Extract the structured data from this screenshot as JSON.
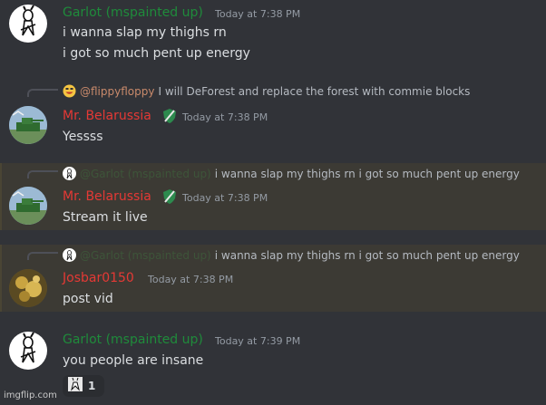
{
  "messages": [
    {
      "username": "Garlot (mspainted up)",
      "timestamp": "Today at 7:38 PM",
      "lines": [
        "i wanna slap my thighs rn",
        "i got so much pent up energy"
      ]
    },
    {
      "reply": {
        "name": "@flippyfloppy",
        "text": "I will DeForest and replace the forest with commie blocks",
        "icon": "grinning-face-emoji-icon"
      },
      "username": "Mr. Belarussia",
      "timestamp": "Today at 7:38 PM",
      "lines": [
        "Yessss"
      ],
      "badge": "sword-shield-icon"
    },
    {
      "reply": {
        "name": "@Garlot (mspainted up)",
        "text": "i wanna slap my thighs rn i got so much pent up energy"
      },
      "username": "Mr. Belarussia",
      "timestamp": "Today at 7:38 PM",
      "lines": [
        "Stream it live"
      ],
      "badge": "sword-shield-icon",
      "highlighted": true
    },
    {
      "reply": {
        "name": "@Garlot (mspainted up)",
        "text": "i wanna slap my thighs rn i got so much pent up energy"
      },
      "username": "Josbar0150",
      "timestamp": "Today at 7:38 PM",
      "lines": [
        "post vid"
      ],
      "highlighted": true
    },
    {
      "username": "Garlot (mspainted up)",
      "timestamp": "Today at 7:39 PM",
      "lines": [
        "you people are insane"
      ],
      "reaction": {
        "count": "1"
      }
    }
  ],
  "colors": {
    "background": "#313338",
    "highlight": "#3c3a34",
    "garlot": "#1f8b3b",
    "belarussia": "#e53935",
    "timestamp": "#949ba4"
  },
  "watermark": "imgflip.com"
}
